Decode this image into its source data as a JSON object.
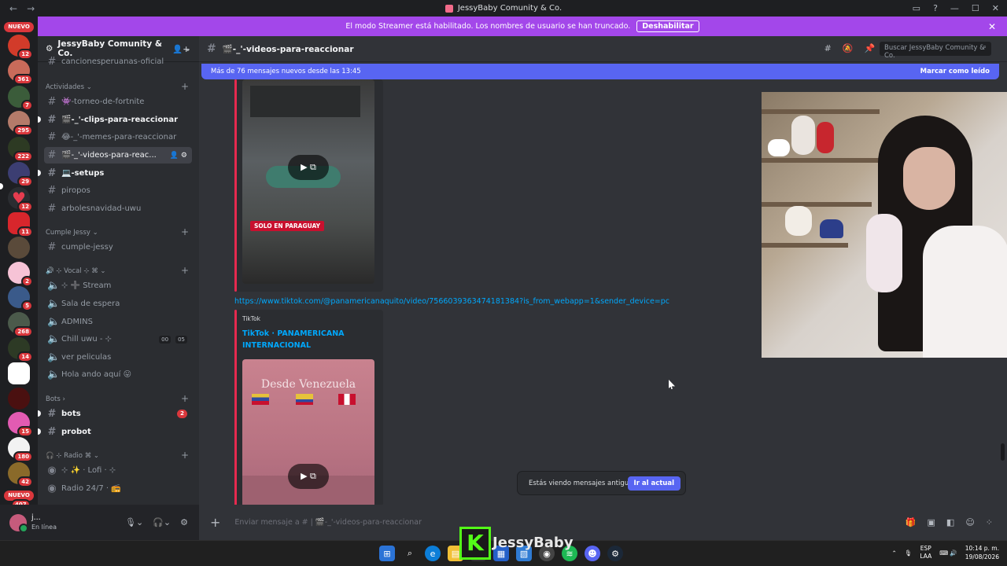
{
  "titlebar": {
    "title": "JessyBaby Comunity & Co.",
    "back": "←",
    "forward": "→"
  },
  "banner": {
    "text": "El modo Streamer está habilitado. Los nombres de usuario se han truncado.",
    "button": "Deshabilitar"
  },
  "guilds": {
    "nuevo_top": "NUEVO",
    "nuevo_bottom": "NUEVO",
    "bottom_count": "407",
    "badges": [
      "12",
      "361",
      "7",
      "295",
      "222",
      "29",
      "12",
      "11",
      "2",
      "5",
      "268",
      "14",
      "15",
      "180",
      "42"
    ]
  },
  "server": {
    "name": "JessyBaby Comunity & Co."
  },
  "channels": {
    "truncated_top": "cancionesperuanas-oficial",
    "categories": {
      "actividades": "Actividades",
      "cumple": "Cumple Jessy",
      "vocal": "🔊 ⊹ Vocal ⊹ ⌘",
      "bots": "Bots",
      "radio": "🎧 ⊹ Radio ⌘"
    },
    "items": [
      {
        "label": "👾-torneo-de-fortnite"
      },
      {
        "label": "🎬-_'-clips-para-reaccionar"
      },
      {
        "label": "😂-_'-memes-para-reaccionar"
      },
      {
        "label": "🎬-_'-videos-para-reac..."
      },
      {
        "label": "💻-setups"
      },
      {
        "label": "piropos"
      },
      {
        "label": "arbolesnavidad-uwu"
      },
      {
        "label": "cumple-jessy"
      },
      {
        "label": "⊹ ➕ Stream"
      },
      {
        "label": "Sala de espera"
      },
      {
        "label": "ADMINS"
      },
      {
        "label": "Chill uwu - ⊹"
      },
      {
        "label": "ver peliculas"
      },
      {
        "label": "Hola ando aquí 😛"
      },
      {
        "label": "bots"
      },
      {
        "label": "probot"
      },
      {
        "label": "⊹ ✨ · Lofi · ⊹"
      },
      {
        "label": "Radio 24/7 · 📻"
      }
    ],
    "chill_tags": [
      "00",
      "05"
    ],
    "bots_count": "2"
  },
  "user": {
    "name": "j...",
    "status": "En línea"
  },
  "header": {
    "channel": "🎬-_'-videos-para-reaccionar",
    "search_placeholder": "Buscar JessyBaby Comunity & Co."
  },
  "newbar": {
    "text": "Más de 76 mensajes nuevos desde las 13:45",
    "mark": "Marcar como leído"
  },
  "messages": {
    "tag_paraguay": "SOLO EN PARAGUAY",
    "link": "https://www.tiktok.com/@panamericanaquito/video/7566039363474181384?is_from_webapp=1&sender_device=pc",
    "provider": "TikTok",
    "embed_title": "TikTok · PANAMERICANA INTERNACIONAL",
    "video_text": "Desde Venezuela"
  },
  "oldmsg": {
    "text": "Estás viendo mensajes antiguos",
    "button": "Ir al actual"
  },
  "composer": {
    "placeholder": "Enviar mensaje a # | 🎬-_'-videos-para-reaccionar"
  },
  "overlay": {
    "letter": "K",
    "name": "JessyBaby"
  },
  "tray": {
    "lang1": "ESP",
    "lang2": "LAA",
    "time": "10:14 p. m.",
    "date": "19/08/2026"
  },
  "colors": {
    "accent": "#5865f2",
    "banner": "#a347ea",
    "danger": "#da373c",
    "link": "#00a8fc",
    "kick": "#53fc18"
  }
}
